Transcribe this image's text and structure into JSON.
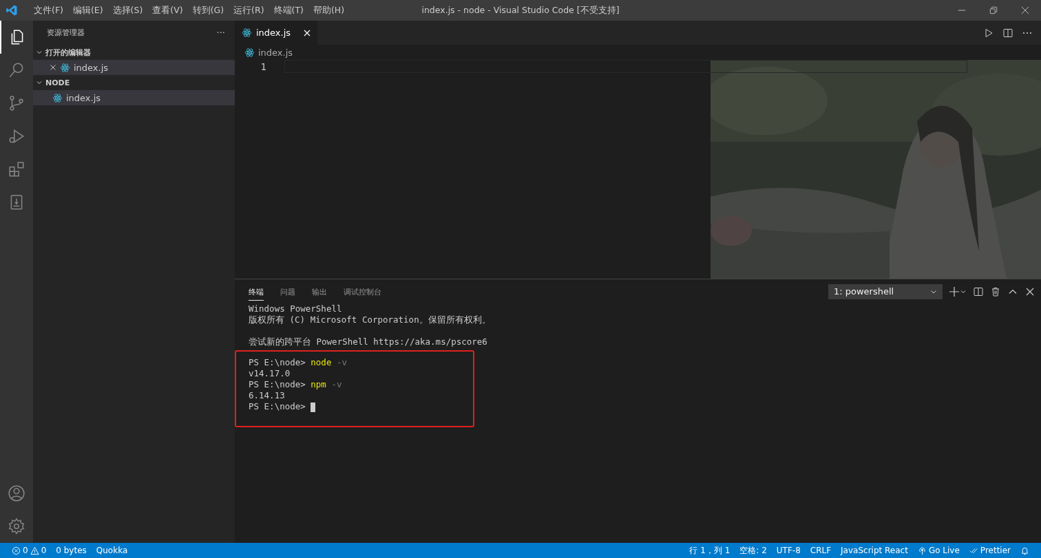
{
  "window": {
    "title": "index.js - node - Visual Studio Code [不受支持]"
  },
  "menu": [
    "文件(F)",
    "编辑(E)",
    "选择(S)",
    "查看(V)",
    "转到(G)",
    "运行(R)",
    "终端(T)",
    "帮助(H)"
  ],
  "activity_bar": [
    {
      "kind": "explorer",
      "selected": true
    },
    {
      "kind": "search",
      "selected": false
    },
    {
      "kind": "source-control",
      "selected": false
    },
    {
      "kind": "run",
      "selected": false
    },
    {
      "kind": "extensions",
      "selected": false
    },
    {
      "kind": "book",
      "selected": false
    }
  ],
  "activity_bar_bottom": [
    {
      "kind": "account"
    },
    {
      "kind": "settings"
    }
  ],
  "sidebar": {
    "title": "资源管理器",
    "more": "···",
    "sections": [
      {
        "title": "打开的编辑器",
        "expanded": true,
        "items": [
          {
            "name": "index.js",
            "closable": true,
            "selected": true
          }
        ]
      },
      {
        "title": "NODE",
        "expanded": true,
        "items": [
          {
            "name": "index.js",
            "closable": false,
            "selected": true
          }
        ]
      }
    ]
  },
  "editor": {
    "tabs": [
      {
        "label": "index.js",
        "selected": true
      }
    ],
    "breadcrumb": "index.js",
    "line_numbers": [
      "1"
    ],
    "background": {
      "kind": "picture"
    }
  },
  "panel": {
    "tabs": [
      {
        "label": "终端",
        "selected": true
      },
      {
        "label": "问题",
        "selected": false
      },
      {
        "label": "输出",
        "selected": false
      },
      {
        "label": "调试控制台",
        "selected": false
      }
    ],
    "terminal_select": "1: powershell",
    "lines": [
      {
        "kind": "text",
        "segments": [
          {
            "kind": "plain",
            "text": "Windows PowerShell"
          }
        ]
      },
      {
        "kind": "text",
        "segments": [
          {
            "kind": "plain",
            "text": "版权所有 (C) Microsoft Corporation。保留所有权利。"
          }
        ]
      },
      {
        "kind": "blank"
      },
      {
        "kind": "text",
        "segments": [
          {
            "kind": "plain",
            "text": "尝试新的跨平台 PowerShell https://aka.ms/pscore6"
          }
        ]
      }
    ],
    "highlighted_block": {
      "lines": [
        {
          "kind": "text",
          "segments": [
            {
              "kind": "plain",
              "text": "PS E:\\node> "
            },
            {
              "kind": "command",
              "text": "node"
            },
            {
              "kind": "arg",
              "text": " -v"
            }
          ]
        },
        {
          "kind": "text",
          "segments": [
            {
              "kind": "plain",
              "text": "v14.17.0"
            }
          ]
        },
        {
          "kind": "text",
          "segments": [
            {
              "kind": "plain",
              "text": "PS E:\\node> "
            },
            {
              "kind": "command",
              "text": "npm"
            },
            {
              "kind": "arg",
              "text": " -v"
            }
          ]
        },
        {
          "kind": "text",
          "segments": [
            {
              "kind": "plain",
              "text": "6.14.13"
            }
          ]
        },
        {
          "kind": "text",
          "cursor": true,
          "segments": [
            {
              "kind": "plain",
              "text": "PS E:\\node> "
            }
          ]
        }
      ]
    }
  },
  "status_bar": {
    "errors": "0",
    "warnings": "0",
    "left": [
      "0 bytes",
      "Quokka"
    ],
    "right": [
      {
        "kind": "text",
        "text": "行 1，列 1"
      },
      {
        "kind": "text",
        "text": "空格: 2"
      },
      {
        "kind": "text",
        "text": "UTF-8"
      },
      {
        "kind": "text",
        "text": "CRLF"
      },
      {
        "kind": "text",
        "text": "JavaScript React"
      },
      {
        "kind": "live",
        "text": "Go Live"
      },
      {
        "kind": "prettier",
        "text": "Prettier"
      },
      {
        "kind": "bell"
      }
    ]
  }
}
